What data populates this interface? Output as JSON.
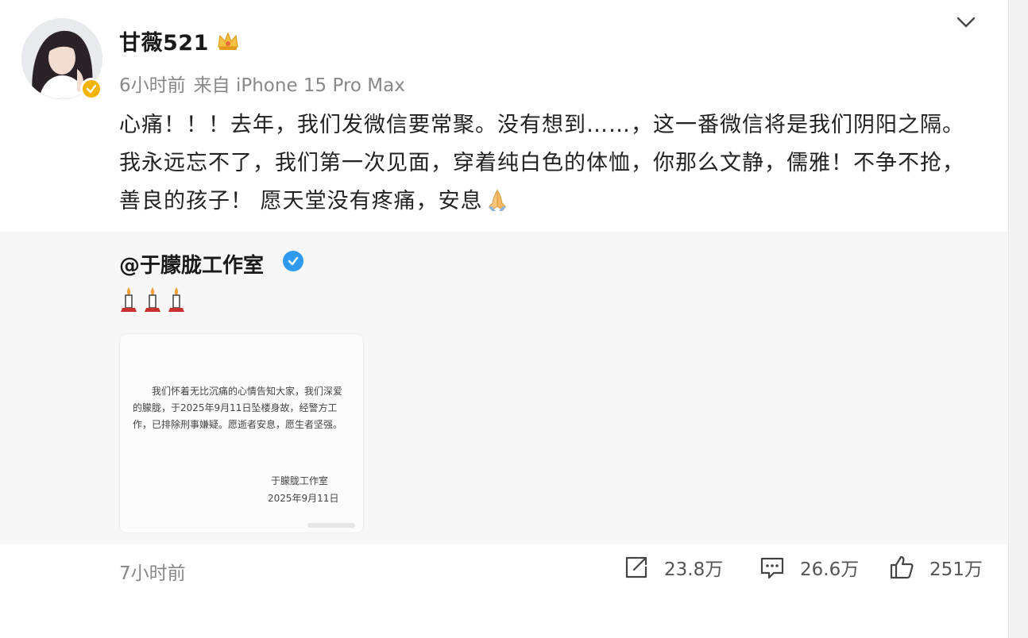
{
  "post": {
    "author": {
      "name": "甘薇521",
      "verified": true,
      "avatar_icon": "avatar-portrait"
    },
    "meta": {
      "time": "6小时前",
      "source": "来自 iPhone 15 Pro Max"
    },
    "text": "心痛！！！去年，我们发微信要常聚。没有想到……，这一番微信将是我们阴阳之隔。我永远忘不了，我们第一次见面，穿着纯白色的体恤，你那么文静，儒雅！不争不抢，善良的孩子！ 愿天堂没有疼痛，安息",
    "text_trailing_emoji": "folded-hands-icon"
  },
  "repost": {
    "author": "@于朦胧工作室",
    "verified_color": "#2e9bf0",
    "emojis": [
      "candle-icon",
      "candle-icon",
      "candle-icon"
    ],
    "notice": {
      "body": "我们怀着无比沉痛的心情告知大家，我们深爱的朦胧，于2025年9月11日坠楼身故，经警方工作，已排除刑事嫌疑。愿逝者安息，愿生者坚强。",
      "signature": "于朦胧工作室",
      "date": "2025年9月11日"
    }
  },
  "footer": {
    "time": "7小时前",
    "actions": [
      {
        "icon": "repost-icon",
        "count": "23.8万"
      },
      {
        "icon": "comment-icon",
        "count": "26.6万"
      },
      {
        "icon": "like-icon",
        "count": "251万"
      }
    ]
  },
  "colors": {
    "verified_gold": "#f5b400",
    "verified_blue": "#2e9bf0",
    "muted_text": "#888888",
    "repost_bg": "#f7f7f7"
  }
}
